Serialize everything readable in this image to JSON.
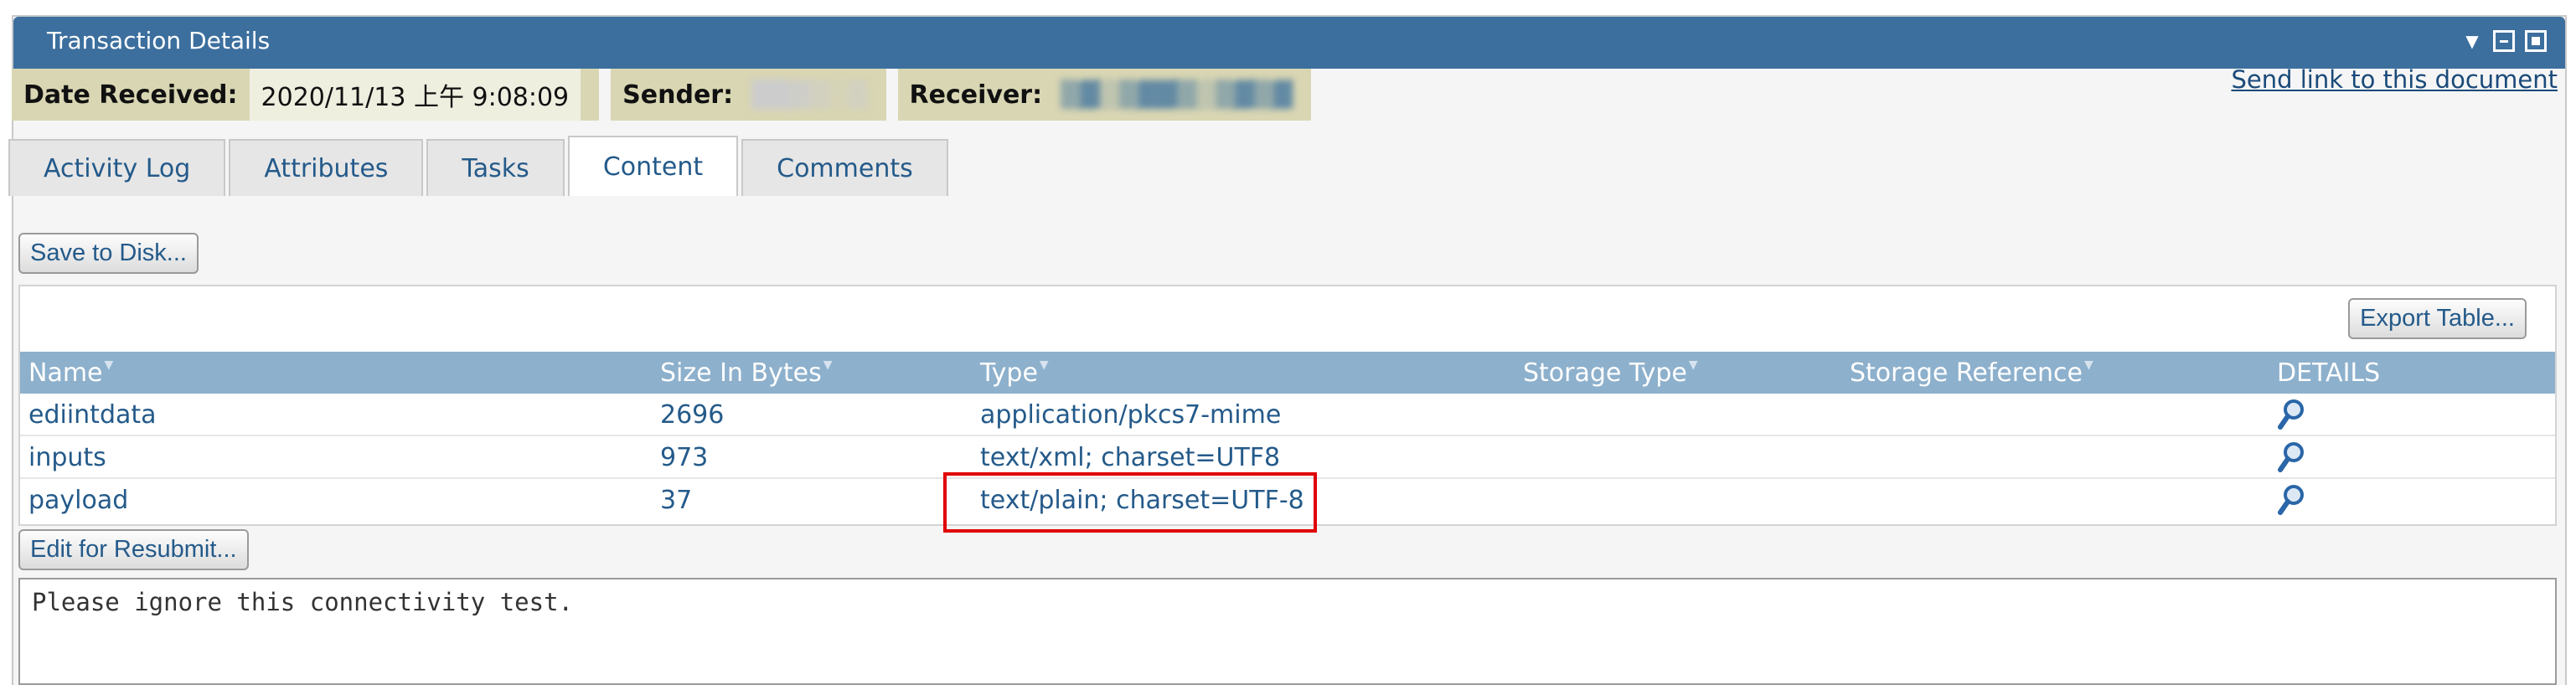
{
  "window": {
    "title": "Transaction Details",
    "controls": [
      "chevron-down-icon",
      "minimize-box-icon",
      "maximize-box-icon"
    ]
  },
  "info": {
    "date_received_label": "Date Received:",
    "date_received_value": "2020/11/13 上午 9:08:09",
    "sender_label": "Sender:",
    "receiver_label": "Receiver:"
  },
  "send_link": "Send link to this document",
  "tabs": [
    {
      "label": "Activity Log",
      "active": false
    },
    {
      "label": "Attributes",
      "active": false
    },
    {
      "label": "Tasks",
      "active": false
    },
    {
      "label": "Content",
      "active": true
    },
    {
      "label": "Comments",
      "active": false
    }
  ],
  "buttons": {
    "save_to_disk": "Save to Disk...",
    "export_table": "Export Table...",
    "edit_for_resubmit": "Edit for Resubmit..."
  },
  "table": {
    "columns": [
      "Name",
      "Size In Bytes",
      "Type",
      "Storage Type",
      "Storage Reference",
      "DETAILS"
    ],
    "rows": [
      {
        "name": "ediintdata",
        "size": "2696",
        "type": "application/pkcs7-mime",
        "storage_type": "",
        "storage_reference": ""
      },
      {
        "name": "inputs",
        "size": "973",
        "type": "text/xml; charset=UTF8",
        "storage_type": "",
        "storage_reference": ""
      },
      {
        "name": "payload",
        "size": "37",
        "type": "text/plain; charset=UTF-8",
        "storage_type": "",
        "storage_reference": ""
      }
    ]
  },
  "content_text": "Please ignore this connectivity test.",
  "colors": {
    "titlebar": "#3c6f9e",
    "info_label_bg": "#d9d6b3",
    "table_header": "#8db0cc",
    "link": "#245a8a",
    "highlight": "#e00000"
  }
}
